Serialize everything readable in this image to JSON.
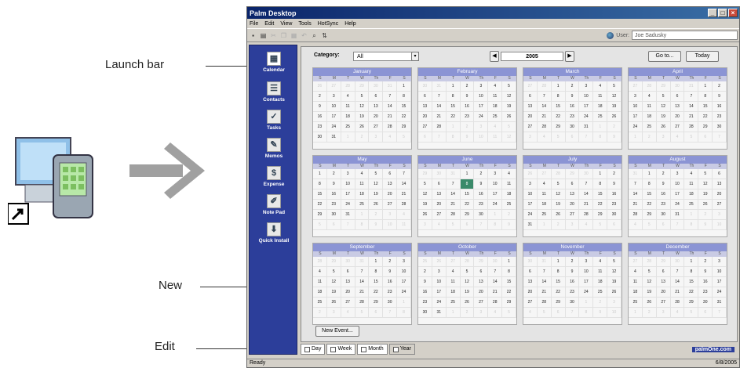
{
  "callouts": {
    "launch_bar": "Launch bar",
    "new": "New",
    "edit": "Edit"
  },
  "window": {
    "title": "Palm Desktop",
    "menus": [
      "File",
      "Edit",
      "View",
      "Tools",
      "HotSync",
      "Help"
    ],
    "user_label": "User:",
    "user_value": "Joe Sadusky",
    "status_left": "Ready",
    "status_right": "6/8/2005",
    "brand": "palmOne.com"
  },
  "launch_bar": {
    "items": [
      {
        "label": "Calendar",
        "icon": "calendar-icon"
      },
      {
        "label": "Contacts",
        "icon": "contacts-icon"
      },
      {
        "label": "Tasks",
        "icon": "tasks-icon"
      },
      {
        "label": "Memos",
        "icon": "memos-icon"
      },
      {
        "label": "Expense",
        "icon": "expense-icon"
      },
      {
        "label": "Note Pad",
        "icon": "notepad-icon"
      },
      {
        "label": "Quick Install",
        "icon": "quick-install-icon"
      }
    ]
  },
  "calendar": {
    "category_label": "Category:",
    "category_value": "All",
    "year": "2005",
    "goto_label": "Go to...",
    "today_label": "Today",
    "new_event_label": "New Event...",
    "weekday_headers": [
      "S",
      "M",
      "T",
      "W",
      "Th",
      "F",
      "S"
    ],
    "months": [
      "January",
      "February",
      "March",
      "April",
      "May",
      "June",
      "July",
      "August",
      "September",
      "October",
      "November",
      "December"
    ],
    "today": {
      "month": 6,
      "day": 8
    }
  },
  "tabs": [
    "Day",
    "Week",
    "Month",
    "Year"
  ],
  "active_tab": "Year"
}
